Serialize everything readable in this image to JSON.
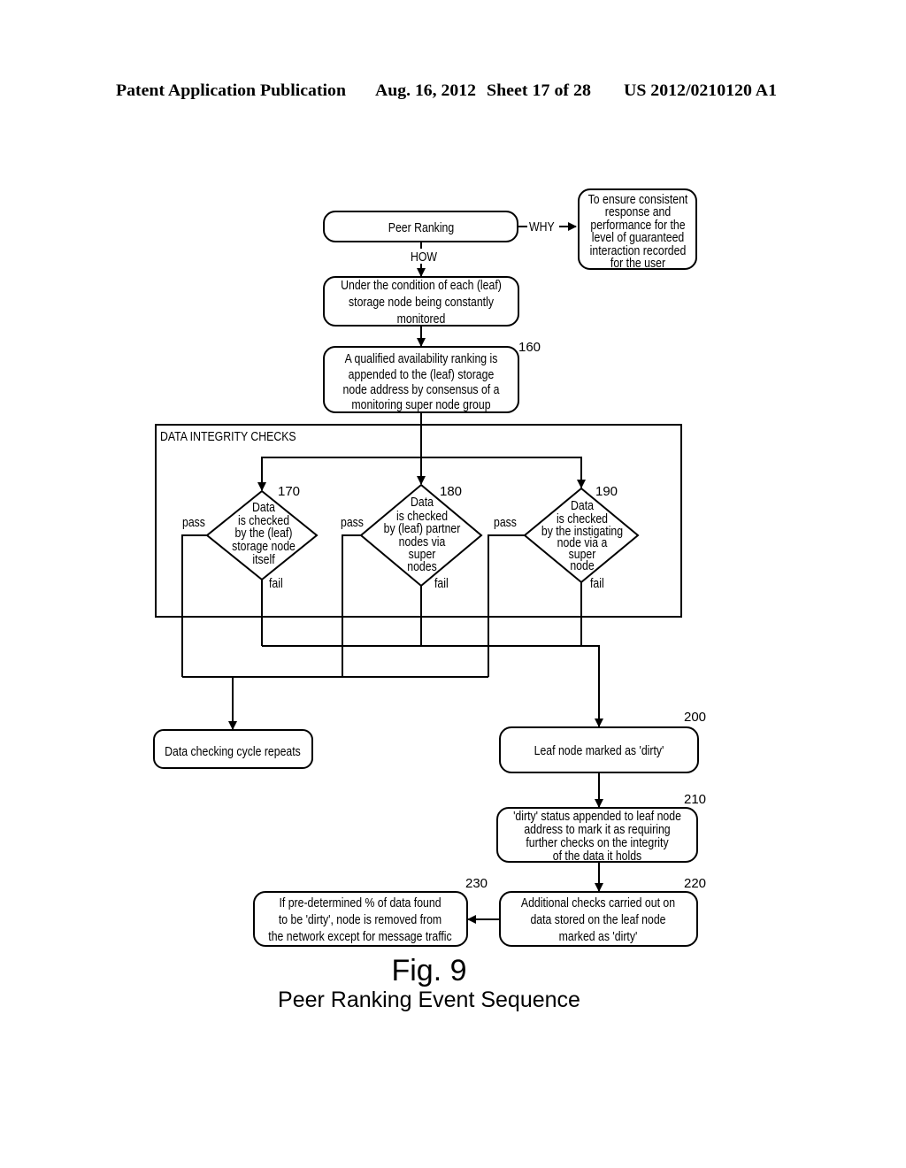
{
  "header": {
    "publication": "Patent Application Publication",
    "date": "Aug. 16, 2012",
    "sheet": "Sheet 17 of 28",
    "number": "US 2012/0210120 A1"
  },
  "edge_labels": {
    "why": "WHY",
    "how": "HOW",
    "pass": "pass",
    "fail": "fail"
  },
  "nodes": {
    "peer_ranking": {
      "lines": [
        "Peer Ranking"
      ]
    },
    "why_goal": {
      "lines": [
        "To ensure consistent",
        "response and",
        "performance for the",
        "level of guaranteed",
        "interaction recorded",
        "for the user"
      ]
    },
    "condition": {
      "lines": [
        "Under the condition of each (leaf)",
        "storage node being constantly",
        "monitored"
      ]
    },
    "ranking": {
      "ref": "160",
      "lines": [
        "A qualified availability ranking is",
        "appended to the (leaf) storage",
        "node address by consensus of a",
        "monitoring super node group"
      ]
    },
    "integrity_group": {
      "title": "DATA INTEGRITY CHECKS"
    },
    "check_self": {
      "ref": "170",
      "lines": [
        "Data",
        "is checked",
        "by the (leaf)",
        "storage node",
        "itself"
      ]
    },
    "check_partner": {
      "ref": "180",
      "lines": [
        "Data",
        "is checked",
        "by (leaf) partner",
        "nodes via",
        "super",
        "nodes"
      ]
    },
    "check_instigating": {
      "ref": "190",
      "lines": [
        "Data",
        "is checked",
        "by the instigating",
        "node via a",
        "super",
        "node"
      ]
    },
    "cycle_repeats": {
      "lines": [
        "Data checking cycle repeats"
      ]
    },
    "marked_dirty": {
      "ref": "200",
      "lines": [
        "Leaf node marked as 'dirty'"
      ]
    },
    "dirty_status": {
      "ref": "210",
      "lines": [
        "'dirty' status appended to leaf node",
        "address to mark it as requiring",
        "further checks on the integrity",
        "of the data it holds"
      ]
    },
    "additional_checks": {
      "ref": "220",
      "lines": [
        "Additional checks carried out on",
        "data stored on the leaf node",
        "marked as 'dirty'"
      ]
    },
    "removal": {
      "ref": "230",
      "lines": [
        "If pre-determined % of data found",
        "to be 'dirty', node is removed from",
        "the network except for message traffic"
      ]
    }
  },
  "figure": {
    "number": "Fig. 9",
    "caption": "Peer Ranking Event Sequence"
  }
}
